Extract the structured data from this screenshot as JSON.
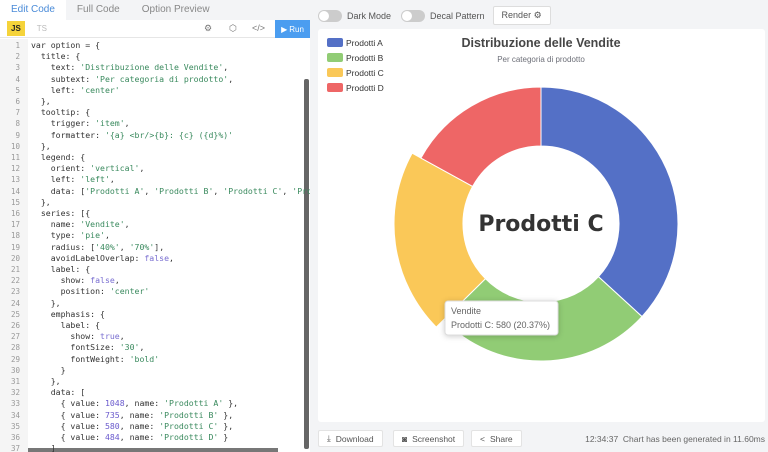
{
  "tabs": [
    "Edit Code",
    "Full Code",
    "Option Preview"
  ],
  "toolbar": {
    "js": "JS",
    "ts": "TS",
    "run": "Run",
    "icons": [
      "settings-icon",
      "box-icon",
      "code-icon"
    ]
  },
  "code": [
    [
      [
        "k",
        "var "
      ],
      [
        "kw",
        ""
      ],
      [
        "k",
        "option = {"
      ]
    ],
    [
      [
        "k",
        "  title: {"
      ]
    ],
    [
      [
        "k",
        "    text: "
      ],
      [
        "s",
        "'Distribuzione delle Vendite'"
      ],
      [
        "k",
        ","
      ]
    ],
    [
      [
        "k",
        "    subtext: "
      ],
      [
        "s",
        "'Per categoria di prodotto'"
      ],
      [
        "k",
        ","
      ]
    ],
    [
      [
        "k",
        "    left: "
      ],
      [
        "s",
        "'center'"
      ]
    ],
    [
      [
        "k",
        "  },"
      ]
    ],
    [
      [
        "k",
        "  tooltip: {"
      ]
    ],
    [
      [
        "k",
        "    trigger: "
      ],
      [
        "s",
        "'item'"
      ],
      [
        "k",
        ","
      ]
    ],
    [
      [
        "k",
        "    formatter: "
      ],
      [
        "s",
        "'{a} <br/>{b}: {c} ({d}%)'"
      ]
    ],
    [
      [
        "k",
        "  },"
      ]
    ],
    [
      [
        "k",
        "  legend: {"
      ]
    ],
    [
      [
        "k",
        "    orient: "
      ],
      [
        "s",
        "'vertical'"
      ],
      [
        "k",
        ","
      ]
    ],
    [
      [
        "k",
        "    left: "
      ],
      [
        "s",
        "'left'"
      ],
      [
        "k",
        ","
      ]
    ],
    [
      [
        "k",
        "    data: ["
      ],
      [
        "s",
        "'Prodotti A'"
      ],
      [
        "k",
        ", "
      ],
      [
        "s",
        "'Prodotti B'"
      ],
      [
        "k",
        ", "
      ],
      [
        "s",
        "'Prodotti C'"
      ],
      [
        "k",
        ", "
      ],
      [
        "s",
        "'Prodotti D'"
      ],
      [
        "k",
        "]"
      ]
    ],
    [
      [
        "k",
        "  },"
      ]
    ],
    [
      [
        "k",
        "  series: [{"
      ]
    ],
    [
      [
        "k",
        "    name: "
      ],
      [
        "s",
        "'Vendite'"
      ],
      [
        "k",
        ","
      ]
    ],
    [
      [
        "k",
        "    type: "
      ],
      [
        "s",
        "'pie'"
      ],
      [
        "k",
        ","
      ]
    ],
    [
      [
        "k",
        "    radius: ["
      ],
      [
        "s",
        "'40%'"
      ],
      [
        "k",
        ", "
      ],
      [
        "s",
        "'70%'"
      ],
      [
        "k",
        "],"
      ]
    ],
    [
      [
        "k",
        "    avoidLabelOverlap: "
      ],
      [
        "kw",
        "false"
      ],
      [
        "k",
        ","
      ]
    ],
    [
      [
        "k",
        "    label: {"
      ]
    ],
    [
      [
        "k",
        "      show: "
      ],
      [
        "kw",
        "false"
      ],
      [
        "k",
        ","
      ]
    ],
    [
      [
        "k",
        "      position: "
      ],
      [
        "s",
        "'center'"
      ]
    ],
    [
      [
        "k",
        "    },"
      ]
    ],
    [
      [
        "k",
        "    emphasis: {"
      ]
    ],
    [
      [
        "k",
        "      label: {"
      ]
    ],
    [
      [
        "k",
        "        show: "
      ],
      [
        "kw",
        "true"
      ],
      [
        "k",
        ","
      ]
    ],
    [
      [
        "k",
        "        fontSize: "
      ],
      [
        "s",
        "'30'"
      ],
      [
        "k",
        ","
      ]
    ],
    [
      [
        "k",
        "        fontWeight: "
      ],
      [
        "s",
        "'bold'"
      ]
    ],
    [
      [
        "k",
        "      }"
      ]
    ],
    [
      [
        "k",
        "    },"
      ]
    ],
    [
      [
        "k",
        "    data: ["
      ]
    ],
    [
      [
        "k",
        "      { value: "
      ],
      [
        "n",
        "1048"
      ],
      [
        "k",
        ", name: "
      ],
      [
        "s",
        "'Prodotti A'"
      ],
      [
        "k",
        " },"
      ]
    ],
    [
      [
        "k",
        "      { value: "
      ],
      [
        "n",
        "735"
      ],
      [
        "k",
        ", name: "
      ],
      [
        "s",
        "'Prodotti B'"
      ],
      [
        "k",
        " },"
      ]
    ],
    [
      [
        "k",
        "      { value: "
      ],
      [
        "n",
        "580"
      ],
      [
        "k",
        ", name: "
      ],
      [
        "s",
        "'Prodotti C'"
      ],
      [
        "k",
        " },"
      ]
    ],
    [
      [
        "k",
        "      { value: "
      ],
      [
        "n",
        "484"
      ],
      [
        "k",
        ", name: "
      ],
      [
        "s",
        "'Prodotti D'"
      ],
      [
        "k",
        " }"
      ]
    ],
    [
      [
        "k",
        "    ]"
      ]
    ]
  ],
  "topbar": {
    "dark_mode": "Dark Mode",
    "decal": "Decal Pattern",
    "render": "Render ⚙"
  },
  "chart_data": {
    "type": "pie",
    "title": "Distribuzione delle Vendite",
    "subtitle": "Per categoria di prodotto",
    "series_name": "Vendite",
    "radius": [
      "40%",
      "70%"
    ],
    "categories": [
      "Prodotti A",
      "Prodotti B",
      "Prodotti C",
      "Prodotti D"
    ],
    "values": [
      1048,
      735,
      580,
      484
    ],
    "colors": [
      "#5470c6",
      "#91cc75",
      "#fac858",
      "#ee6666"
    ],
    "emphasized": "Prodotti C",
    "center_label": "Prodotti C",
    "legend_placement": "top-left",
    "tooltip": {
      "title": "Vendite",
      "text": "Prodotti C: 580 (20.37%)"
    }
  },
  "bottom": {
    "download": "Download",
    "screenshot": "Screenshot",
    "share": "Share",
    "time": "12:34:37",
    "status": "Chart has been generated in 11.60ms"
  }
}
